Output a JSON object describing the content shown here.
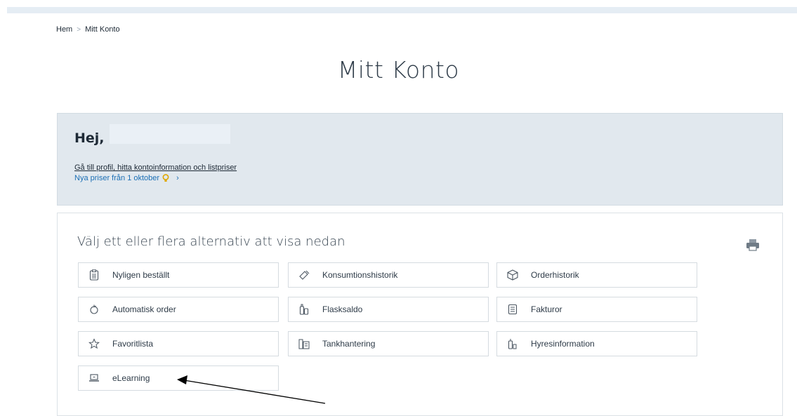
{
  "breadcrumb": {
    "home": "Hem",
    "separator": ">",
    "current": "Mitt Konto"
  },
  "page": {
    "title": "Mitt Konto"
  },
  "greeting": {
    "hello": "Hej,",
    "profile_link": "Gå till profil, hitta kontoinformation och listpriser",
    "new_prices": "Nya priser från 1 oktober",
    "chevron": "›"
  },
  "options": {
    "heading": "Välj ett eller flera alternativ att visa nedan",
    "items": [
      {
        "label": "Nyligen beställt",
        "icon": "clipboard-icon"
      },
      {
        "label": "Konsumtionshistorik",
        "icon": "cylinder-icon"
      },
      {
        "label": "Orderhistorik",
        "icon": "box-icon"
      },
      {
        "label": "Automatisk order",
        "icon": "refresh-icon"
      },
      {
        "label": "Flasksaldo",
        "icon": "bottles-icon"
      },
      {
        "label": "Fakturor",
        "icon": "invoice-icon"
      },
      {
        "label": "Favoritlista",
        "icon": "star-icon"
      },
      {
        "label": "Tankhantering",
        "icon": "tank-icon"
      },
      {
        "label": "Hyresinformation",
        "icon": "rental-icon"
      },
      {
        "label": "eLearning",
        "icon": "laptop-icon"
      }
    ]
  },
  "colors": {
    "accent": "#1b6fb5",
    "greeting_bg": "#e1e8ee",
    "top_bar": "#e5edf4",
    "bulb": "#f0b400"
  }
}
